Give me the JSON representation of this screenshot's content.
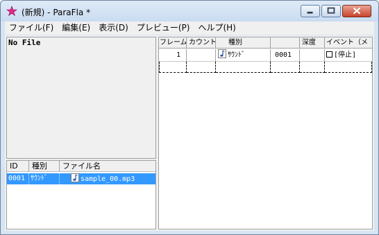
{
  "window": {
    "title": "(新規) - ParaFla *"
  },
  "menu": [
    {
      "label": "ファイル(F)"
    },
    {
      "label": "編集(E)"
    },
    {
      "label": "表示(D)"
    },
    {
      "label": "プレビュー(P)"
    },
    {
      "label": "ヘルプ(H)"
    }
  ],
  "file_pane": {
    "title": "No File"
  },
  "library": {
    "columns": [
      "ID",
      "種別",
      "ファイル名"
    ],
    "rows": [
      {
        "id": "0001",
        "type": "ｻｳﾝﾄﾞ",
        "filename": "sample_00.mp3",
        "icon": "music-note-icon"
      }
    ]
  },
  "timeline": {
    "columns": [
      "フレーム",
      "カウント",
      "種別",
      "",
      "深度",
      "イベント（メ"
    ],
    "rows": [
      {
        "frame": "1",
        "count": "",
        "type": "ｻｳﾝﾄﾞ",
        "id": "0001",
        "depth": "",
        "event": "[停止]",
        "icon": "music-note-icon"
      }
    ]
  },
  "colors": {
    "selection": "#3399ff",
    "close_button": "#c8432a"
  }
}
